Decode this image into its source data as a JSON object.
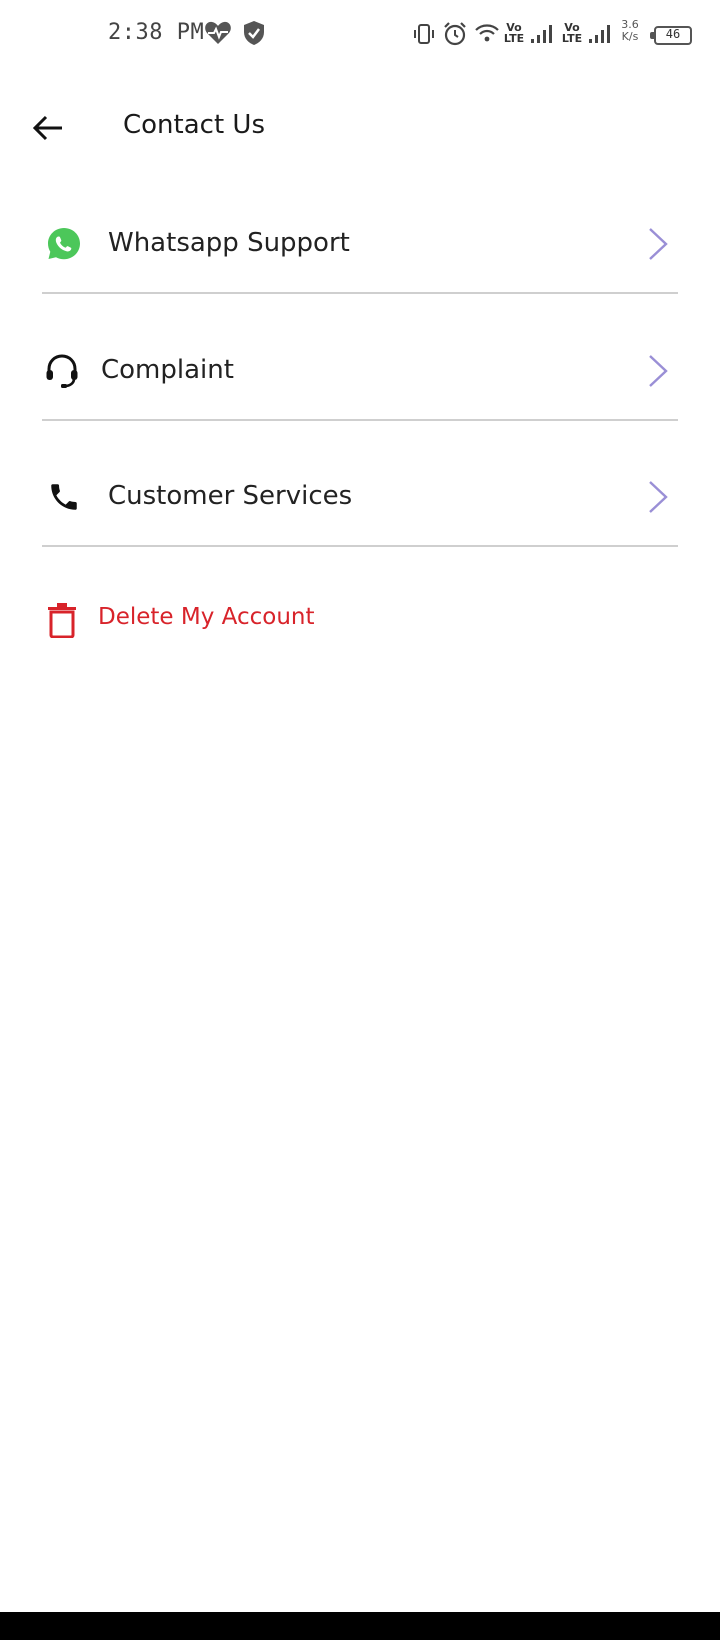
{
  "status_bar": {
    "time": "2:38 PM",
    "icons": [
      "heart-pulse-icon",
      "shield-check-icon",
      "vibrate-icon",
      "alarm-icon",
      "wifi-icon",
      "signal-icon",
      "signal-icon",
      "battery-icon"
    ],
    "sim1_top": "Vo",
    "sim1_bottom": "LTE",
    "sim2_top": "Vo",
    "sim2_bottom": "LTE",
    "speed_value": "3.6",
    "speed_unit": "K/s",
    "battery_level": "46"
  },
  "header": {
    "title": "Contact Us",
    "back_icon": "arrow-left-icon"
  },
  "menu": {
    "items": [
      {
        "label": "Whatsapp Support",
        "icon": "whatsapp-icon",
        "icon_color": "#4cc75a"
      },
      {
        "label": "Complaint",
        "icon": "headset-icon",
        "icon_color": "#111111"
      },
      {
        "label": "Customer Services",
        "icon": "phone-icon",
        "icon_color": "#111111"
      }
    ],
    "chevron_color": "#9a8fd6"
  },
  "delete_account": {
    "label": "Delete My Account",
    "icon": "trash-icon",
    "color": "#d8232a"
  }
}
